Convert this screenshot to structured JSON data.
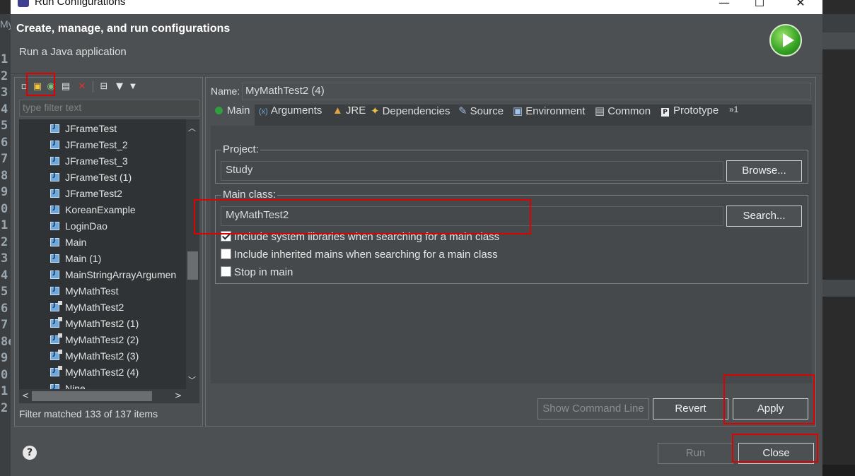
{
  "window": {
    "title": "Run Configurations",
    "min_icon": "minimize-icon",
    "max_icon": "maximize-icon",
    "close_icon": "close-icon"
  },
  "background_ide": {
    "gutter_numbers": [
      "1",
      "2",
      "3",
      "4",
      "5",
      "6",
      "7",
      "8",
      "9",
      "0",
      "1",
      "2",
      "3",
      "4",
      "5",
      "6",
      "7",
      "8e",
      "9",
      "0",
      "1",
      "2"
    ],
    "top_left_text": "My"
  },
  "header": {
    "title": "Create, manage, and run configurations",
    "subtitle": "Run a Java application"
  },
  "toolbar": {
    "icons": [
      "new-configuration-icon",
      "new-prototype-icon",
      "export-icon",
      "duplicate-icon",
      "delete-icon",
      "collapse-all-icon",
      "filter-icon",
      "dropdown-arrow-icon"
    ]
  },
  "filter": {
    "placeholder": "type filter text"
  },
  "tree": {
    "items": [
      {
        "label": "JFrameTest",
        "pinned": false
      },
      {
        "label": "JFrameTest_2",
        "pinned": false
      },
      {
        "label": "JFrameTest_3",
        "pinned": false
      },
      {
        "label": "JFrameTest (1)",
        "pinned": false
      },
      {
        "label": "JFrameTest2",
        "pinned": false
      },
      {
        "label": "KoreanExample",
        "pinned": false
      },
      {
        "label": "LoginDao",
        "pinned": false
      },
      {
        "label": "Main",
        "pinned": false
      },
      {
        "label": "Main (1)",
        "pinned": false
      },
      {
        "label": "MainStringArrayArgumen",
        "pinned": false
      },
      {
        "label": "MyMathTest",
        "pinned": false
      },
      {
        "label": "MyMathTest2",
        "pinned": true
      },
      {
        "label": "MyMathTest2 (1)",
        "pinned": true
      },
      {
        "label": "MyMathTest2 (2)",
        "pinned": true
      },
      {
        "label": "MyMathTest2 (3)",
        "pinned": true
      },
      {
        "label": "MyMathTest2 (4)",
        "pinned": true
      },
      {
        "label": "Nine",
        "pinned": false
      }
    ],
    "status": "Filter matched 133 of 137 items"
  },
  "config": {
    "name_label": "Name:",
    "name_value": "MyMathTest2 (4)",
    "tabs": [
      {
        "label": "Main",
        "icon": "main-tab-icon"
      },
      {
        "label": "Arguments",
        "icon": "arguments-tab-icon"
      },
      {
        "label": "JRE",
        "icon": "jre-tab-icon"
      },
      {
        "label": "Dependencies",
        "icon": "dependencies-tab-icon"
      },
      {
        "label": "Source",
        "icon": "source-tab-icon"
      },
      {
        "label": "Environment",
        "icon": "environment-tab-icon"
      },
      {
        "label": "Common",
        "icon": "common-tab-icon"
      },
      {
        "label": "Prototype",
        "icon": "prototype-tab-icon"
      },
      {
        "label": "»1",
        "icon": "more-tabs-icon"
      }
    ],
    "project": {
      "label": "Project:",
      "value": "Study",
      "browse": "Browse..."
    },
    "main_class": {
      "label": "Main class:",
      "value": "MyMathTest2",
      "search": "Search..."
    },
    "checkboxes": [
      {
        "label": "Include system libraries when searching for a main class",
        "checked": true
      },
      {
        "label": "Include inherited mains when searching for a main class",
        "checked": false
      },
      {
        "label": "Stop in main",
        "checked": false
      }
    ]
  },
  "buttons": {
    "show_command_line": "Show Command Line",
    "revert": "Revert",
    "apply": "Apply",
    "run": "Run",
    "close": "Close"
  },
  "help_icon": "help-icon",
  "highlight_color": "#e00000"
}
